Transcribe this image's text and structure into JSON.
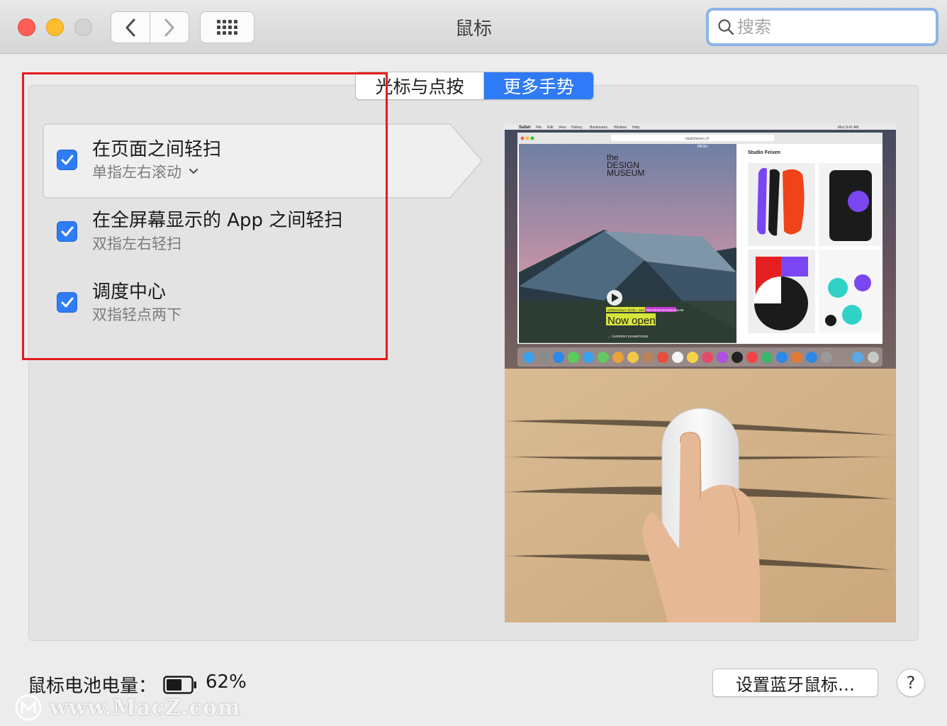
{
  "window": {
    "title": "鼠标",
    "search_placeholder": "搜索"
  },
  "icons": {
    "back": "chevron-left-icon",
    "forward": "chevron-right-icon",
    "show_all": "grid-icon",
    "search": "search-icon",
    "checkbox": "checkmark-icon",
    "battery": "battery-icon",
    "help": "question-mark-icon"
  },
  "tabs": [
    {
      "label": "光标与点按",
      "selected": false
    },
    {
      "label": "更多手势",
      "selected": true
    }
  ],
  "gestures": [
    {
      "title": "在页面之间轻扫",
      "subtitle": "单指左右滚动",
      "checked": true,
      "has_dropdown": true,
      "selected": true
    },
    {
      "title": "在全屏幕显示的 App 之间轻扫",
      "subtitle": "双指左右轻扫",
      "checked": true,
      "has_dropdown": false,
      "selected": false
    },
    {
      "title": "调度中心",
      "subtitle": "双指轻点两下",
      "checked": true,
      "has_dropdown": false,
      "selected": false
    }
  ],
  "preview": {
    "menubar_app": "Safari",
    "menubar_items": [
      "File",
      "Edit",
      "View",
      "History",
      "Bookmarks",
      "Window",
      "Help"
    ],
    "menubar_clock": "Mon 9:41 AM",
    "url": "studiofeixen.ch",
    "menu_label": "MENU",
    "museum_logo": [
      "the",
      "DESIGN",
      "MUSEUM"
    ],
    "tag_open": "OPEN DAILY 10:00 – 18:00",
    "tag_hashtag": "#MOREDESIGNMUSEUM",
    "now_open": "Now open",
    "current_exhibitions": "→ CURRENT EXHIBITIONS",
    "sidebar_title": "Studio Feixen"
  },
  "battery": {
    "label": "鼠标电池电量：",
    "level": 0.62,
    "percent_text": "62%"
  },
  "buttons": {
    "setup_bluetooth": "设置蓝牙鼠标…",
    "help": "?"
  },
  "colors": {
    "accent": "#2f7af6",
    "highlight": "#e41c1c",
    "close": "#fd5f57",
    "minimize": "#febc2e"
  },
  "watermark": "www.MacZ.com"
}
